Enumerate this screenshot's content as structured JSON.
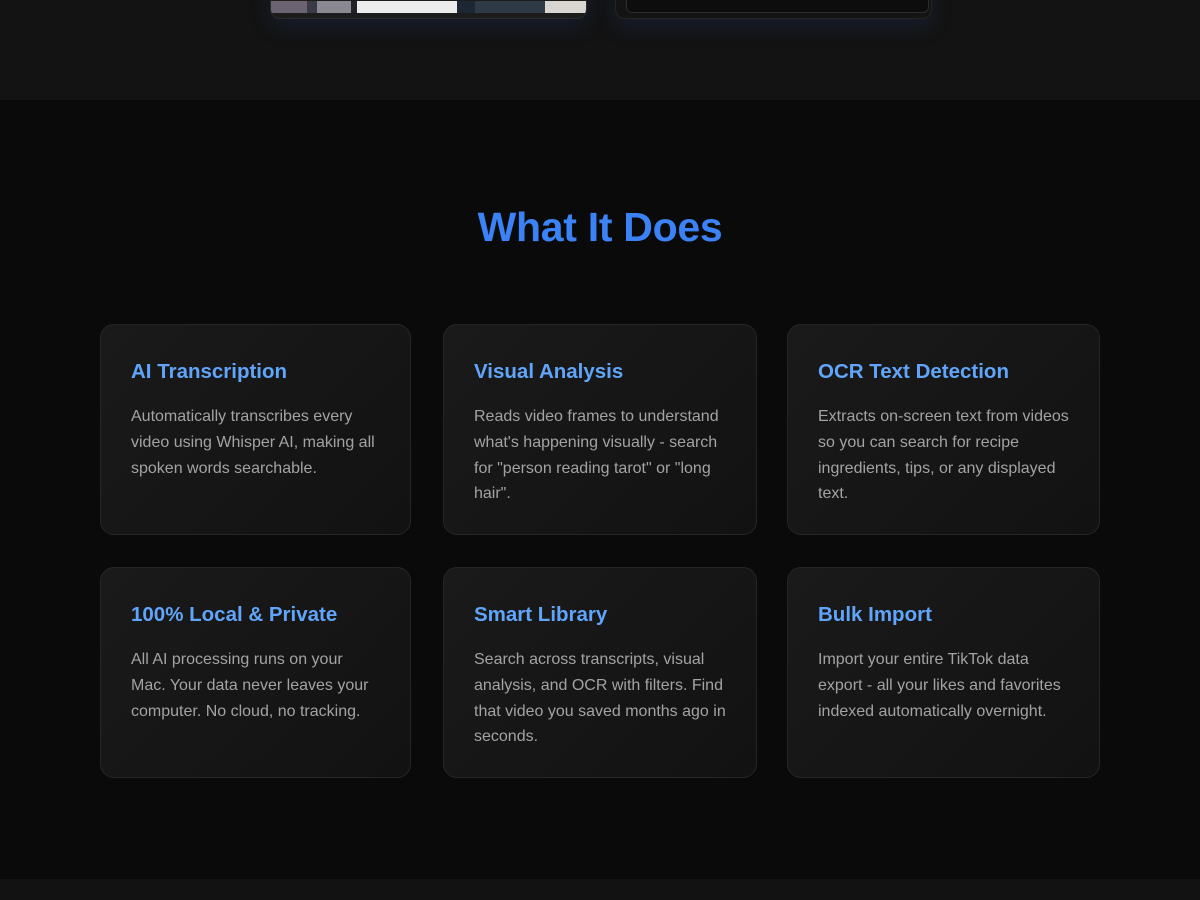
{
  "section": {
    "title": "What It Does"
  },
  "features": [
    {
      "title": "AI Transcription",
      "description": "Automatically transcribes every video using Whisper AI, making all spoken words searchable."
    },
    {
      "title": "Visual Analysis",
      "description": "Reads video frames to understand what's happening visually - search for \"person reading tarot\" or \"long hair\"."
    },
    {
      "title": "OCR Text Detection",
      "description": "Extracts on-screen text from videos so you can search for recipe ingredients, tips, or any displayed text."
    },
    {
      "title": "100% Local & Private",
      "description": "All AI processing runs on your Mac. Your data never leaves your computer. No cloud, no tracking."
    },
    {
      "title": "Smart Library",
      "description": "Search across transcripts, visual analysis, and OCR with filters. Find that video you saved months ago in seconds."
    },
    {
      "title": "Bulk Import",
      "description": "Import your entire TikTok data export - all your likes and favorites indexed automatically overnight."
    }
  ],
  "colors": {
    "accent": "#3b82f6",
    "card_title": "#60a5fa",
    "body_text": "#a3a3a3",
    "background": "#0a0a0a"
  }
}
